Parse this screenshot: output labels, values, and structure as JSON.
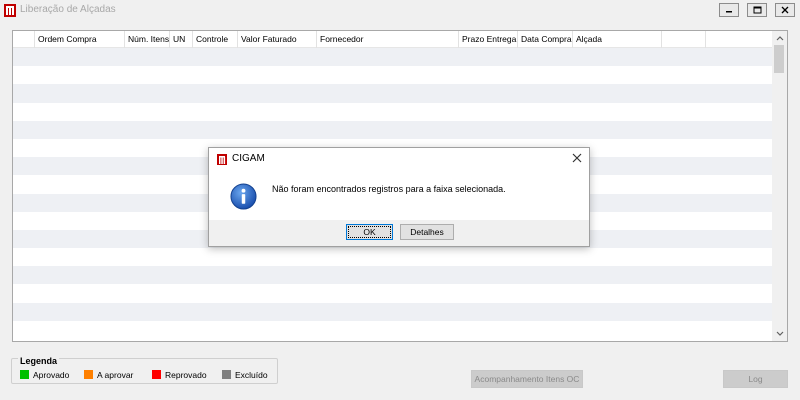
{
  "window": {
    "title": "Liberação de Alçadas",
    "controls": [
      "minimize-icon",
      "restore-icon",
      "close-icon"
    ]
  },
  "grid": {
    "columns": [
      "",
      "Ordem Compra",
      "Núm. Itens",
      "UN",
      "Controle",
      "Valor Faturado",
      "Fornecedor",
      "Prazo Entrega",
      "Data Compra",
      "Alçada",
      "",
      ""
    ],
    "row_count": 16
  },
  "legend": {
    "title": "Legenda",
    "items": [
      {
        "label": "Aprovado",
        "color": "#00c000"
      },
      {
        "label": "A aprovar",
        "color": "#ff8000"
      },
      {
        "label": "Reprovado",
        "color": "#ff0000"
      },
      {
        "label": "Excluído",
        "color": "#808080"
      }
    ]
  },
  "buttons": {
    "acompanhamento": "Acompanhamento Itens OC",
    "log": "Log"
  },
  "dialog": {
    "title": "CIGAM",
    "message": "Não foram encontrados registros para a faixa selecionada.",
    "ok_label": "OK",
    "details_label": "Detalhes"
  },
  "colors": {
    "brand_red": "#c00000",
    "row_stripe": "#eef0f4",
    "info_blue": "#1f5fbf"
  }
}
